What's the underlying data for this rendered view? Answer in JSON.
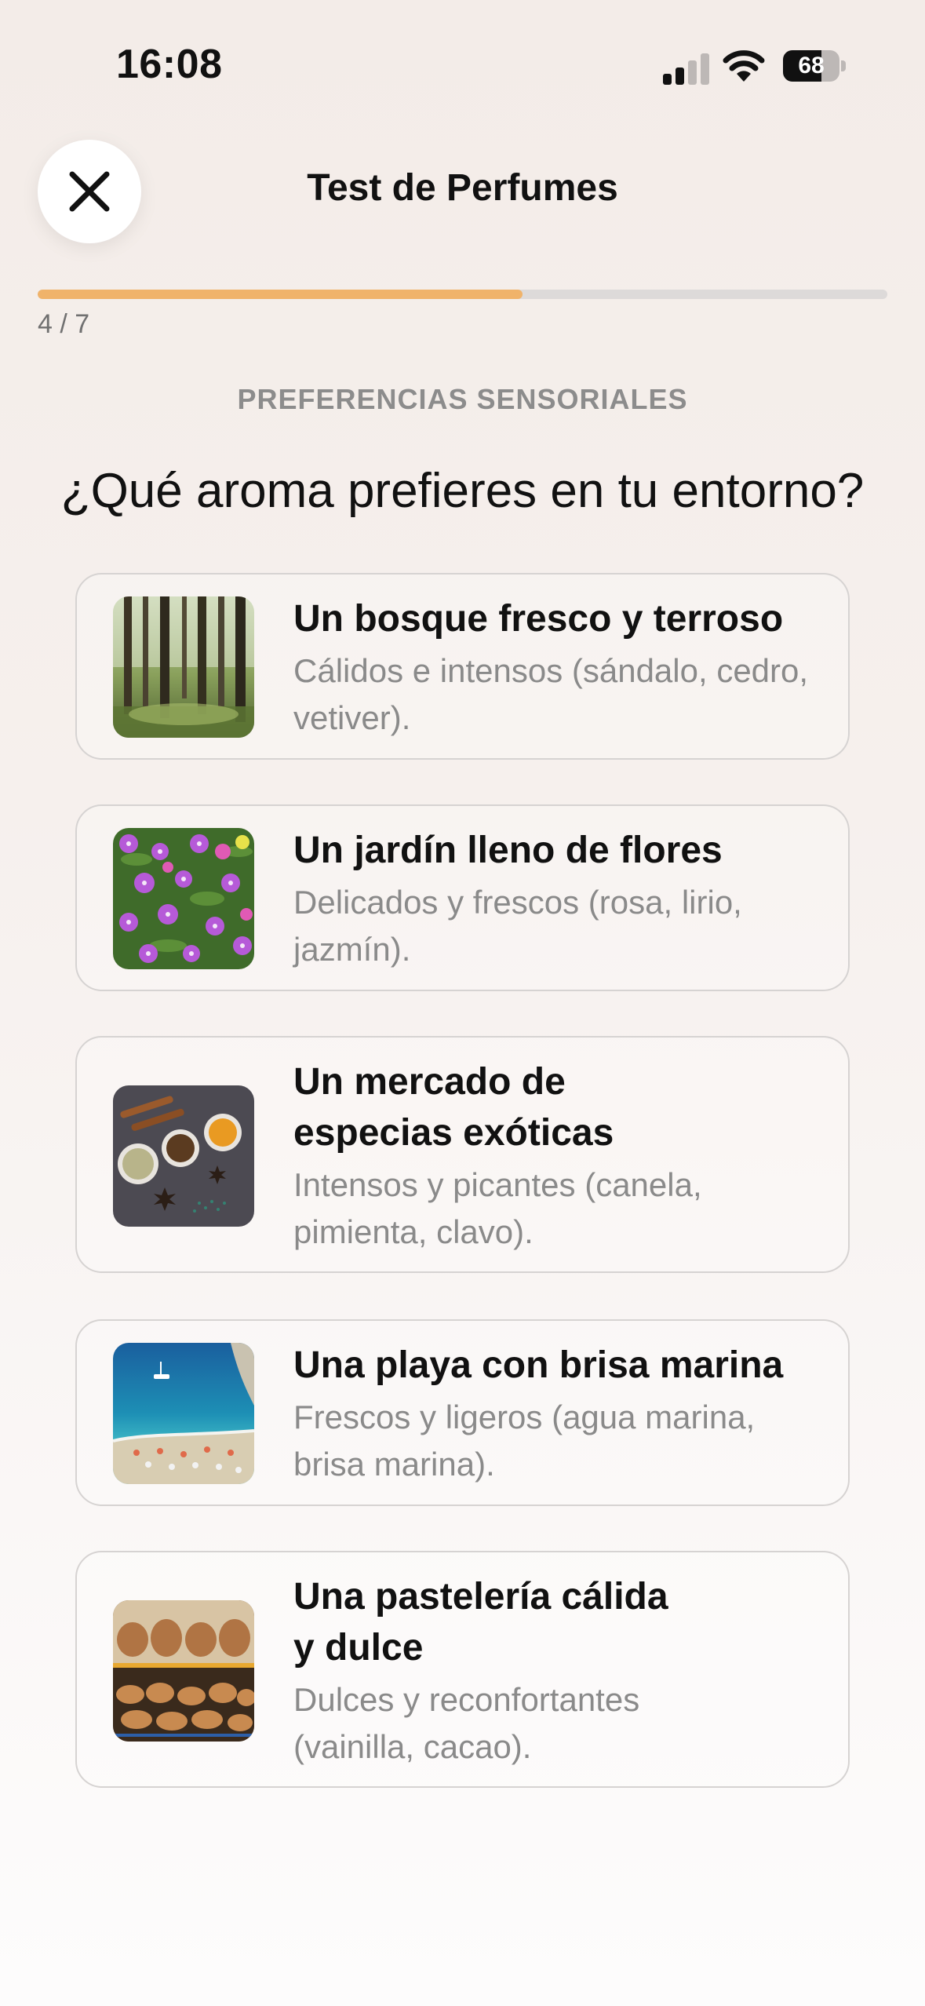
{
  "status_bar": {
    "time": "16:08",
    "battery_percent": "68",
    "battery_level": 0.68
  },
  "header": {
    "title": "Test de Perfumes"
  },
  "progress": {
    "label": "4 / 7",
    "fraction": 0.571
  },
  "section_label": "PREFERENCIAS SENSORIALES",
  "question": "¿Qué aroma prefieres en tu entorno?",
  "options": [
    {
      "title": "Un bosque fresco y terroso",
      "description": "Cálidos e intensos (sándalo, cedro, vetiver).",
      "image": "forest-image"
    },
    {
      "title": "Un jardín lleno de flores",
      "description": "Delicados y frescos (rosa, lirio, jazmín).",
      "image": "flowers-image"
    },
    {
      "title": "Un mercado de especias exóticas",
      "description": "Intensos y picantes (canela, pimienta, clavo).",
      "image": "spices-image"
    },
    {
      "title": "Una playa con brisa marina",
      "description": "Frescos y ligeros (agua marina, brisa marina).",
      "image": "beach-image"
    },
    {
      "title": "Una pastelería cálida y dulce",
      "description": "Dulces y reconfortantes (vainilla, cacao).",
      "image": "bakery-image"
    }
  ]
}
